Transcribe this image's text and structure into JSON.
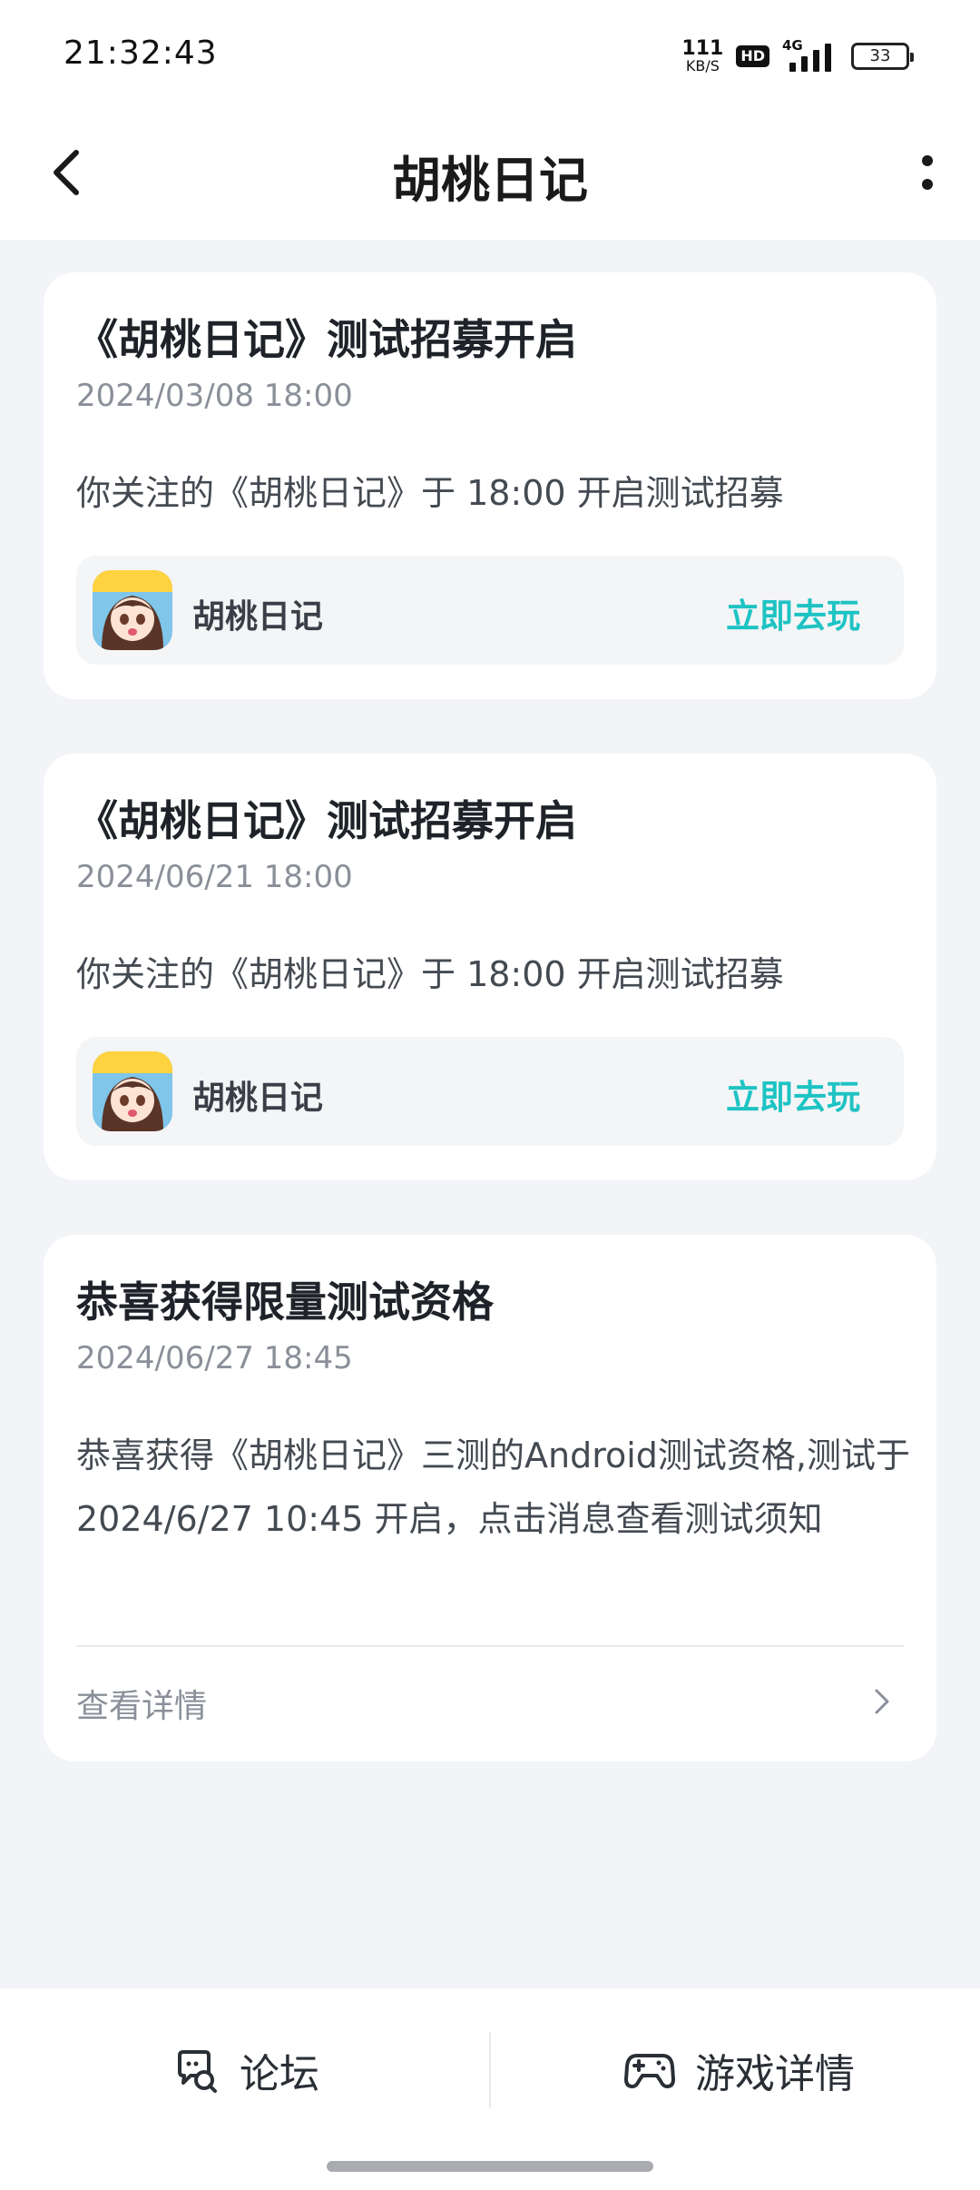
{
  "status_bar": {
    "time": "21:32:43",
    "net_speed_value": "111",
    "net_speed_unit": "KB/S",
    "hd_label": "HD",
    "network_type": "4G",
    "battery_level": "33"
  },
  "header": {
    "title": "胡桃日记",
    "back_icon": "chevron-left-icon",
    "more_icon": "more-vertical-icon"
  },
  "messages": [
    {
      "title": "《胡桃日记》测试招募开启",
      "date": "2024/03/08 18:00",
      "body": "你关注的《胡桃日记》于 18:00 开启测试招募",
      "game_name": "胡桃日记",
      "action_label": "立即去玩"
    },
    {
      "title": "《胡桃日记》测试招募开启",
      "date": "2024/06/21 18:00",
      "body": "你关注的《胡桃日记》于 18:00 开启测试招募",
      "game_name": "胡桃日记",
      "action_label": "立即去玩"
    },
    {
      "title": "恭喜获得限量测试资格",
      "date": "2024/06/27 18:45",
      "body": "恭喜获得《胡桃日记》三测的Android测试资格,测试于 2024/6/27 10:45 开启，点击消息查看测试须知",
      "detail_label": "查看详情"
    }
  ],
  "bottom_bar": {
    "forum_label": "论坛",
    "game_detail_label": "游戏详情"
  },
  "colors": {
    "accent": "#1ec3c3",
    "background": "#f2f4f7",
    "card": "#ffffff"
  }
}
